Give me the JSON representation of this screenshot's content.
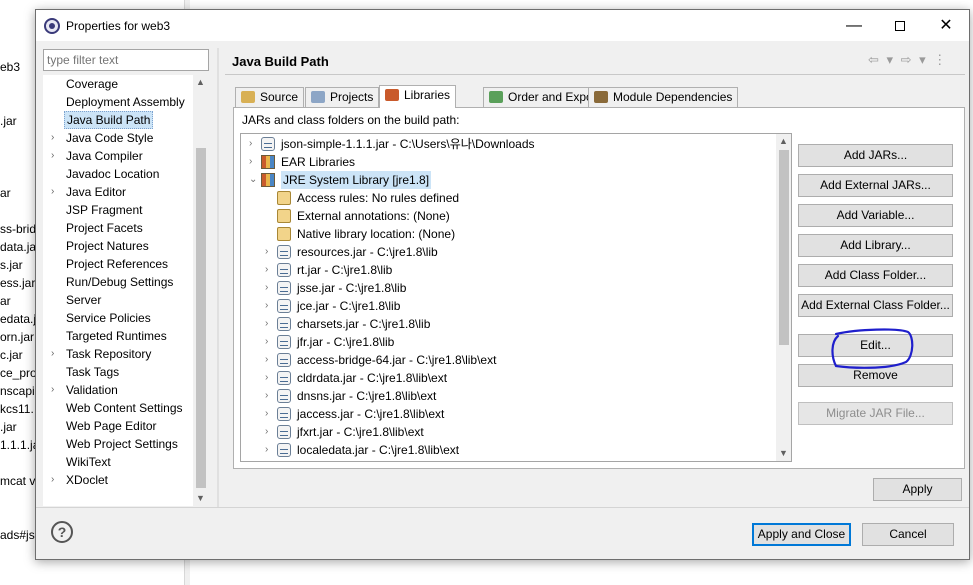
{
  "background": {
    "fragments": [
      "eb3",
      ".jar",
      "ar",
      "ss-brid",
      "data.jar",
      "s.jar",
      "ess.jar",
      "ar",
      "edata.j",
      "orn.jar",
      "c.jar",
      "ce_prov",
      "nscapi.",
      "kcs11.",
      ".jar",
      "1.1.1.ja",
      "mcat v",
      "ads#js"
    ]
  },
  "window": {
    "title": "Properties for web3",
    "minimize": "—",
    "close": "✕"
  },
  "nav": {
    "filter_placeholder": "type filter text",
    "items": [
      {
        "label": "Coverage",
        "expandable": false
      },
      {
        "label": "Deployment Assembly",
        "expandable": false
      },
      {
        "label": "Java Build Path",
        "expandable": false,
        "selected": true
      },
      {
        "label": "Java Code Style",
        "expandable": true
      },
      {
        "label": "Java Compiler",
        "expandable": true
      },
      {
        "label": "Javadoc Location",
        "expandable": false
      },
      {
        "label": "Java Editor",
        "expandable": true
      },
      {
        "label": "JSP Fragment",
        "expandable": false
      },
      {
        "label": "Project Facets",
        "expandable": false
      },
      {
        "label": "Project Natures",
        "expandable": false
      },
      {
        "label": "Project References",
        "expandable": false
      },
      {
        "label": "Run/Debug Settings",
        "expandable": false
      },
      {
        "label": "Server",
        "expandable": false
      },
      {
        "label": "Service Policies",
        "expandable": false
      },
      {
        "label": "Targeted Runtimes",
        "expandable": false
      },
      {
        "label": "Task Repository",
        "expandable": true
      },
      {
        "label": "Task Tags",
        "expandable": false
      },
      {
        "label": "Validation",
        "expandable": true
      },
      {
        "label": "Web Content Settings",
        "expandable": false
      },
      {
        "label": "Web Page Editor",
        "expandable": false
      },
      {
        "label": "Web Project Settings",
        "expandable": false
      },
      {
        "label": "WikiText",
        "expandable": false
      },
      {
        "label": "XDoclet",
        "expandable": true
      }
    ]
  },
  "page": {
    "title": "Java Build Path",
    "nav_arrows": "⇦ ▾ ⇨ ▾ ⋮"
  },
  "tabs": [
    {
      "label": "Source",
      "icon": "source-folder-icon",
      "active": false
    },
    {
      "label": "Projects",
      "icon": "project-folder-icon",
      "active": false
    },
    {
      "label": "Libraries",
      "icon": "library-icon",
      "active": true
    },
    {
      "label": "Order and Export",
      "icon": "order-export-icon",
      "active": false
    },
    {
      "label": "Module Dependencies",
      "icon": "module-icon",
      "active": false
    }
  ],
  "libraries": {
    "caption": "JARs and class folders on the build path:",
    "rows": [
      {
        "level": 0,
        "expander": "›",
        "icon": "jar",
        "text": "json-simple-1.1.1.jar - C:\\Users\\유나\\Downloads"
      },
      {
        "level": 0,
        "expander": "›",
        "icon": "lib",
        "text": "EAR Libraries"
      },
      {
        "level": 0,
        "expander": "⌄",
        "icon": "lib",
        "text": "JRE System Library [jre1.8]"
      },
      {
        "level": 1,
        "expander": "",
        "icon": "info",
        "text": "Access rules: No rules defined"
      },
      {
        "level": 1,
        "expander": "",
        "icon": "info",
        "text": "External annotations: (None)"
      },
      {
        "level": 1,
        "expander": "",
        "icon": "info",
        "text": "Native library location: (None)"
      },
      {
        "level": 1,
        "expander": "›",
        "icon": "jar",
        "text": "resources.jar - C:\\jre1.8\\lib"
      },
      {
        "level": 1,
        "expander": "›",
        "icon": "jar",
        "text": "rt.jar - C:\\jre1.8\\lib"
      },
      {
        "level": 1,
        "expander": "›",
        "icon": "jar",
        "text": "jsse.jar - C:\\jre1.8\\lib"
      },
      {
        "level": 1,
        "expander": "›",
        "icon": "jar",
        "text": "jce.jar - C:\\jre1.8\\lib"
      },
      {
        "level": 1,
        "expander": "›",
        "icon": "jar",
        "text": "charsets.jar - C:\\jre1.8\\lib"
      },
      {
        "level": 1,
        "expander": "›",
        "icon": "jar",
        "text": "jfr.jar - C:\\jre1.8\\lib"
      },
      {
        "level": 1,
        "expander": "›",
        "icon": "jar",
        "text": "access-bridge-64.jar - C:\\jre1.8\\lib\\ext"
      },
      {
        "level": 1,
        "expander": "›",
        "icon": "jar",
        "text": "cldrdata.jar - C:\\jre1.8\\lib\\ext"
      },
      {
        "level": 1,
        "expander": "›",
        "icon": "jar",
        "text": "dnsns.jar - C:\\jre1.8\\lib\\ext"
      },
      {
        "level": 1,
        "expander": "›",
        "icon": "jar",
        "text": "jaccess.jar - C:\\jre1.8\\lib\\ext"
      },
      {
        "level": 1,
        "expander": "›",
        "icon": "jar",
        "text": "jfxrt.jar - C:\\jre1.8\\lib\\ext"
      },
      {
        "level": 1,
        "expander": "›",
        "icon": "jar",
        "text": "localedata.jar - C:\\jre1.8\\lib\\ext"
      }
    ]
  },
  "side_buttons": [
    {
      "label": "Add JARs...",
      "enabled": true
    },
    {
      "label": "Add External JARs...",
      "enabled": true
    },
    {
      "label": "Add Variable...",
      "enabled": true
    },
    {
      "label": "Add Library...",
      "enabled": true
    },
    {
      "label": "Add Class Folder...",
      "enabled": true
    },
    {
      "label": "Add External Class Folder...",
      "enabled": true
    },
    {
      "label": "Edit...",
      "enabled": true
    },
    {
      "label": "Remove",
      "enabled": true
    },
    {
      "label": "Migrate JAR File...",
      "enabled": false
    }
  ],
  "annotation_color": "#1f1fcc",
  "footer": {
    "apply": "Apply",
    "apply_and_close": "Apply and Close",
    "cancel": "Cancel",
    "help": "?"
  }
}
